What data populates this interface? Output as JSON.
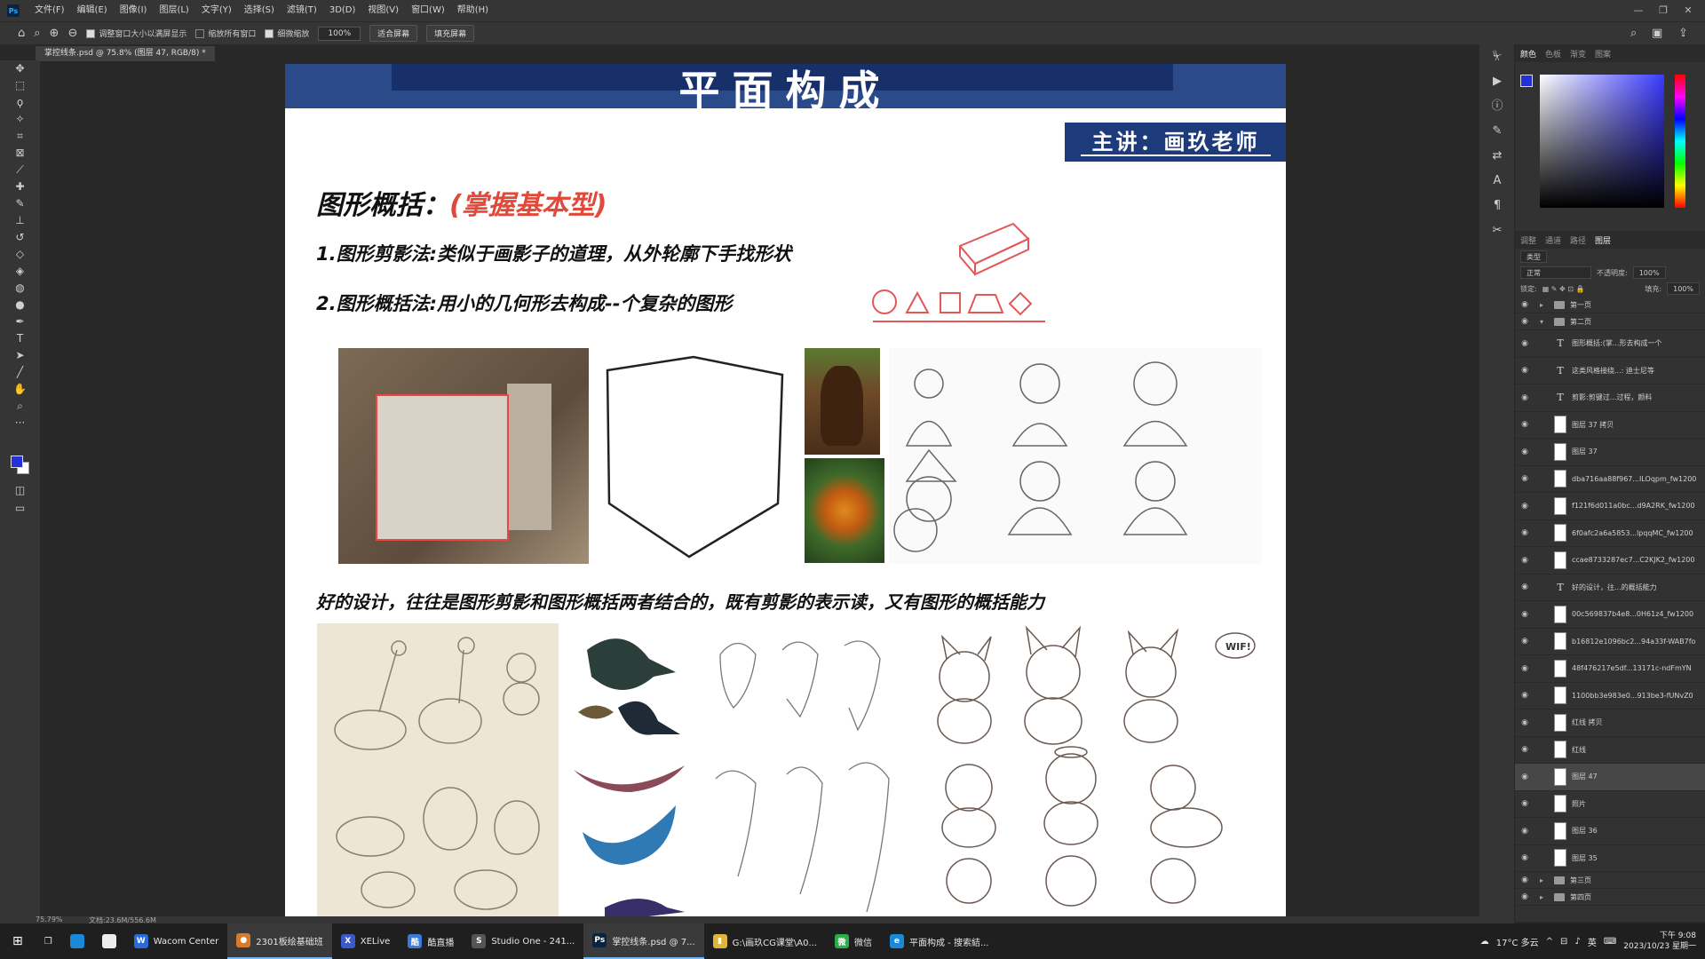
{
  "menubar": {
    "app_logo": "Ps",
    "items": [
      "文件(F)",
      "编辑(E)",
      "图像(I)",
      "图层(L)",
      "文字(Y)",
      "选择(S)",
      "滤镜(T)",
      "3D(D)",
      "视图(V)",
      "窗口(W)",
      "帮助(H)"
    ]
  },
  "options": {
    "resize_windows": "调整窗口大小以满屏显示",
    "zoom_all": "缩放所有窗口",
    "scrubby_zoom": "细微缩放",
    "zoom_value": "100%",
    "fit_screen": "适合屏幕",
    "fill_screen": "填充屏幕"
  },
  "document_tab": "掌控线条.psd @ 75.8% (图层 47, RGB/8) *",
  "document": {
    "banner_title": "平面构成",
    "teacher": "主讲：画玖老师",
    "heading_main_prefix": "图形概括：",
    "heading_main_highlight": "(掌握基本型)",
    "line1": "1.图形剪影法:类似于画影子的道理，从外轮廓下手找形状",
    "line2": "2.图形概括法:用小的几何形去构成--个复杂的图形",
    "design_line": "好的设计，往往是图形剪影和图形概括两者结合的，既有剪影的表示读，又有图形的概括能力"
  },
  "panels": {
    "color_tabs": [
      "颜色",
      "色板",
      "渐变",
      "图案"
    ],
    "layer_tabs": [
      "调整",
      "通道",
      "路径",
      "图层"
    ],
    "layer_filter": "类型",
    "blend_mode": "正常",
    "opacity_label": "不透明度:",
    "opacity_value": "100%",
    "lock_label": "锁定:",
    "fill_label": "填充:",
    "fill_value": "100%"
  },
  "layers": [
    {
      "kind": "group",
      "name": "第一页",
      "open": false
    },
    {
      "kind": "group",
      "name": "第二页",
      "open": true
    },
    {
      "kind": "text",
      "name": "图形概括:(掌...形去构成一个"
    },
    {
      "kind": "text",
      "name": "这类风格接绕...: 迪士尼等"
    },
    {
      "kind": "text",
      "name": "剪影:剪键过...过程，颜料"
    },
    {
      "kind": "pixel",
      "name": "图层 37 拷贝"
    },
    {
      "kind": "pixel",
      "name": "图层 37"
    },
    {
      "kind": "pixel",
      "name": "dba716aa88f967...ILOqpm_fw1200"
    },
    {
      "kind": "pixel",
      "name": "f121f6d011a0bc...d9A2RK_fw1200"
    },
    {
      "kind": "pixel",
      "name": "6f0afc2a6a5853...lpqqMC_fw1200"
    },
    {
      "kind": "pixel",
      "name": "ccae8733287ec7...C2KJK2_fw1200"
    },
    {
      "kind": "text",
      "name": "好的设计，往...的概括能力"
    },
    {
      "kind": "pixel",
      "name": "00c569837b4e8...0H61z4_fw1200"
    },
    {
      "kind": "pixel",
      "name": "b16812e1096bc2...94a33f-WAB7fo"
    },
    {
      "kind": "pixel",
      "name": "48f476217e5df...13171c-ndFmYN"
    },
    {
      "kind": "pixel",
      "name": "1100bb3e983e0...913be3-fUNvZ0"
    },
    {
      "kind": "pixel",
      "name": "红线 拷贝"
    },
    {
      "kind": "pixel",
      "name": "红线"
    },
    {
      "kind": "pixel",
      "name": "图层 47",
      "selected": true
    },
    {
      "kind": "pixel",
      "name": "照片"
    },
    {
      "kind": "pixel",
      "name": "图层 36"
    },
    {
      "kind": "pixel",
      "name": "图层 35"
    },
    {
      "kind": "group",
      "name": "第三页",
      "open": false
    },
    {
      "kind": "group",
      "name": "第四页",
      "open": false
    }
  ],
  "status": {
    "zoom": "75.79%",
    "doc_size": "文档:23.6M/556.6M"
  },
  "taskbar": {
    "apps": [
      {
        "label": "Wacom Center",
        "color": "#2a6bd8",
        "glyph": "W"
      },
      {
        "label": "2301板绘基础班",
        "color": "#d77a2a",
        "glyph": "●",
        "active": true
      },
      {
        "label": "XELive",
        "color": "#3a5ac8",
        "glyph": "X"
      },
      {
        "label": "酷直播",
        "color": "#3a7ad8",
        "glyph": "酷"
      },
      {
        "label": "Studio One - 241...",
        "color": "#555",
        "glyph": "S"
      },
      {
        "label": "掌控线条.psd @ 7...",
        "color": "#0a2340",
        "glyph": "Ps",
        "active": true
      },
      {
        "label": "G:\\画玖CG课堂\\A0...",
        "color": "#e0b53a",
        "glyph": "▮"
      },
      {
        "label": "微信",
        "color": "#2aae4a",
        "glyph": "微"
      },
      {
        "label": "平面构成 - 搜索結...",
        "color": "#1a8ad8",
        "glyph": "e"
      }
    ],
    "weather": "17°C 多云",
    "ime": "英",
    "time": "下午 9:08",
    "date": "2023/10/23 星期一"
  },
  "colors": {
    "accent": "#2430d8",
    "banner": "#2b4a8a",
    "highlight_red": "#e04a3a"
  }
}
